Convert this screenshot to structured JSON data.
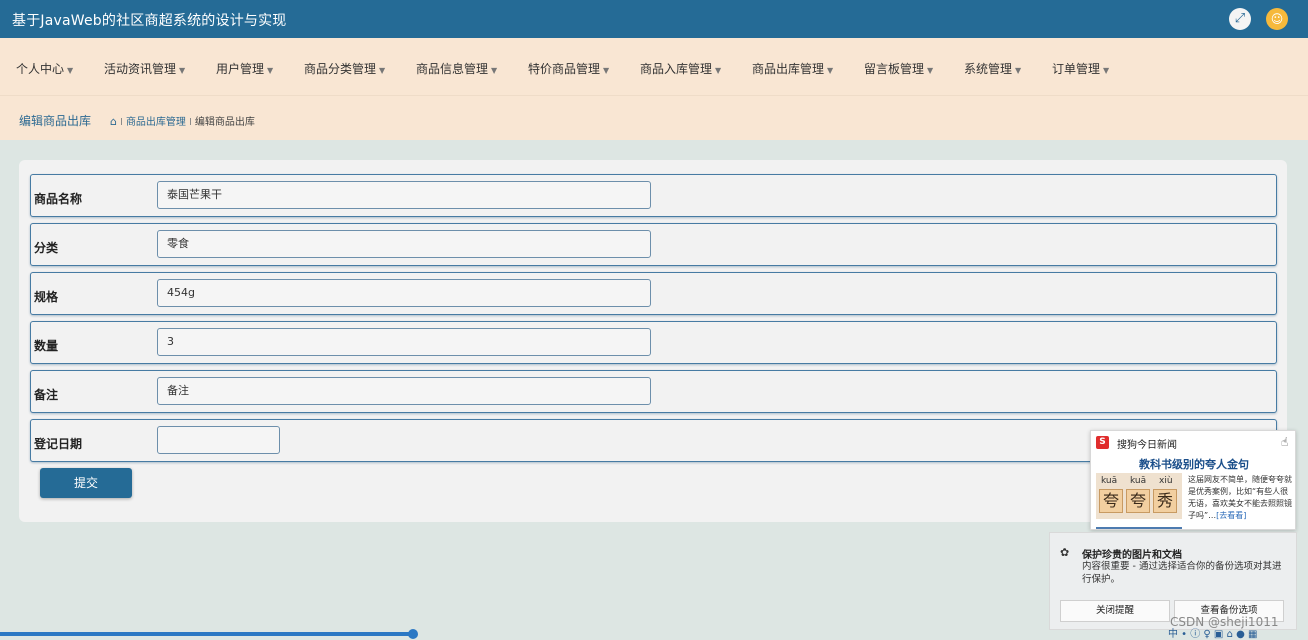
{
  "app": {
    "title": "基于JavaWeb的社区商超系统的设计与实现"
  },
  "header": {
    "fullscreen_icon": "fullscreen-icon",
    "user_icon": "user-avatar-icon"
  },
  "nav": [
    "个人中心",
    "活动资讯管理",
    "用户管理",
    "商品分类管理",
    "商品信息管理",
    "特价商品管理",
    "商品入库管理",
    "商品出库管理",
    "留言板管理",
    "系统管理",
    "订单管理"
  ],
  "page": {
    "heading": "编辑商品出库",
    "breadcrumb": {
      "home_icon": "home-icon",
      "sep": "I",
      "parent": "商品出库管理",
      "current": "编辑商品出库"
    }
  },
  "form": {
    "fields": [
      {
        "label": "商品名称",
        "value": "泰国芒果干"
      },
      {
        "label": "分类",
        "value": "零食"
      },
      {
        "label": "规格",
        "value": "454g"
      },
      {
        "label": "数量",
        "value": "3"
      },
      {
        "label": "备注",
        "value": "备注"
      },
      {
        "label": "登记日期",
        "value": ""
      }
    ],
    "submit": "提交"
  },
  "news_popup": {
    "source": "搜狗今日新闻",
    "logo_letter": "S",
    "headline": "教科书级别的夸人金句",
    "pinyin": [
      "kuā",
      "kuā",
      "xiù"
    ],
    "chars": [
      "夸",
      "夸",
      "秀"
    ],
    "snippet": "这届网友不简单，随便夸夸就是优秀案例，比如“有些人很无语，喜欢美女不能去照照镜子吗”…",
    "more": "[去看看]"
  },
  "backup_popup": {
    "title": "保护珍贵的图片和文档",
    "desc": "内容很重要 - 通过选择适合你的备份选项对其进行保护。",
    "close_btn": "关闭提醒",
    "view_btn": "查看备份选项"
  },
  "taskbar": {
    "tray": "中 • ⓘ ♀ ▣ ⌂ ● ▦"
  },
  "watermark": "CSDN @sheji1011",
  "colors": {
    "primary": "#256b96",
    "nav_bg": "#f9e6d3",
    "content_bg": "#dde6e3",
    "card_bg": "#f2f2f2"
  }
}
